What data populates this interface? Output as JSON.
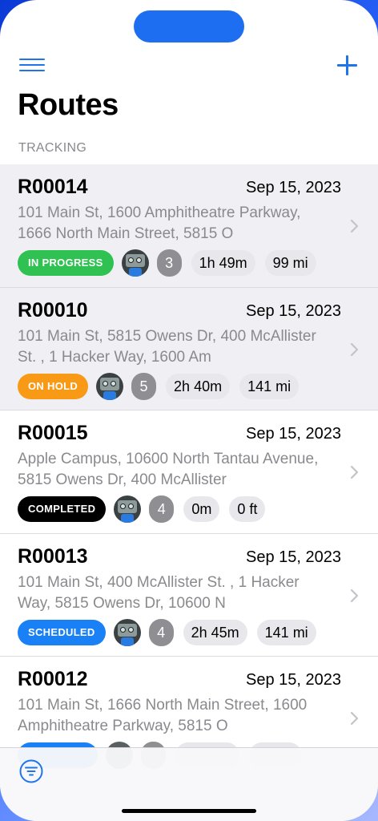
{
  "header": {
    "title": "Routes",
    "section": "TRACKING",
    "menu_icon": "hamburger-menu-icon",
    "add_icon": "plus-icon"
  },
  "colors": {
    "accent": "#1f74ea",
    "in_progress": "#2fc151",
    "on_hold": "#f99a16",
    "completed": "#000000",
    "scheduled": "#1a80f6"
  },
  "routes": [
    {
      "id": "R00014",
      "date": "Sep 15, 2023",
      "address": "101 Main St, 1600 Amphitheatre Parkway, 1666 North Main Street, 5815 O",
      "status": "IN PROGRESS",
      "status_color": "#2fc151",
      "stops": "3",
      "duration": "1h 49m",
      "distance": "99 mi",
      "selected": true
    },
    {
      "id": "R00010",
      "date": "Sep 15, 2023",
      "address": "101 Main St, 5815 Owens Dr, 400 McAllister St. , 1 Hacker Way, 1600 Am",
      "status": "ON HOLD",
      "status_color": "#f99a16",
      "stops": "5",
      "duration": "2h 40m",
      "distance": "141 mi",
      "selected": true
    },
    {
      "id": "R00015",
      "date": "Sep 15, 2023",
      "address": "Apple Campus, 10600 North Tantau Avenue, 5815 Owens Dr, 400 McAllister",
      "status": "COMPLETED",
      "status_color": "#000000",
      "stops": "4",
      "duration": "0m",
      "distance": "0 ft",
      "selected": false
    },
    {
      "id": "R00013",
      "date": "Sep 15, 2023",
      "address": "101 Main St, 400 McAllister St. , 1 Hacker Way, 5815 Owens Dr, 10600 N",
      "status": "SCHEDULED",
      "status_color": "#1a80f6",
      "stops": "4",
      "duration": "2h 45m",
      "distance": "141 mi",
      "selected": false
    },
    {
      "id": "R00012",
      "date": "Sep 15, 2023",
      "address": "101 Main St, 1666 North Main Street, 1600 Amphitheatre Parkway, 5815 O",
      "status": "",
      "status_color": "#1a80f6",
      "stops": "",
      "duration": "",
      "distance": "",
      "selected": false
    }
  ],
  "tabbar": {
    "filter_icon": "filter-icon"
  }
}
